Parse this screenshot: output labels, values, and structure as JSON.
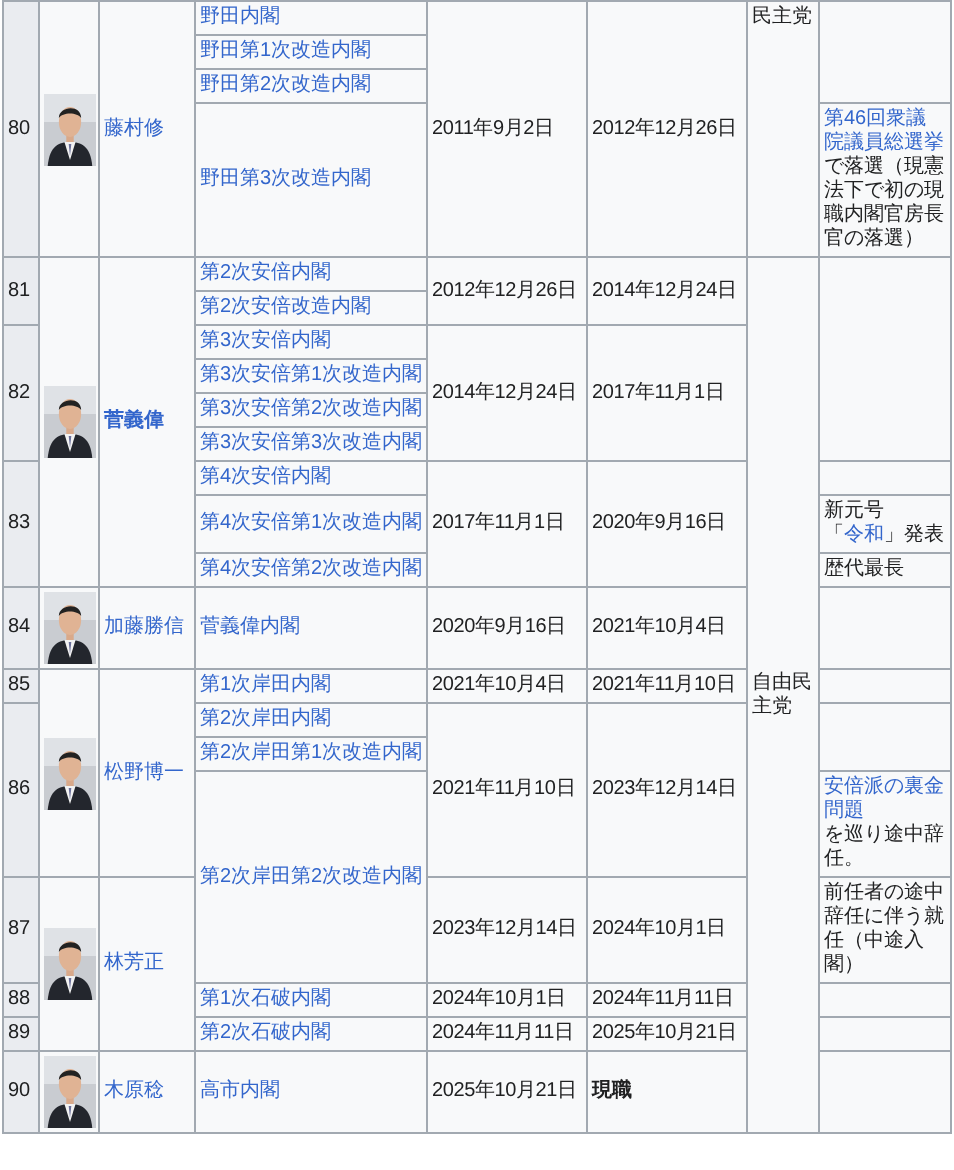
{
  "table": {
    "rows": [
      {
        "number": "80",
        "photo": {
          "kind": "picture"
        },
        "name": {
          "text": "藤村修"
        },
        "cabinet": "野田内閣",
        "start": "2011年9月2日",
        "end": {
          "text": "2012年12月26日"
        },
        "party": {
          "text": "民主党",
          "continued": true
        },
        "note": null
      },
      {
        "cabinet": "野田第1次改造内閣"
      },
      {
        "cabinet": "野田第2次改造内閣"
      },
      {
        "cabinet": "野田第3次改造内閣",
        "note": [
          {
            "text": "第46回衆議院議員総選挙",
            "link": true
          },
          {
            "text": "で落選（現憲法下で初の現職内閣官房長官の落選）",
            "link": false
          }
        ]
      },
      {
        "number": "81",
        "photo": {
          "kind": "picture"
        },
        "name": {
          "text": "菅義偉",
          "bold": true
        },
        "cabinet": "第2次安倍内閣",
        "start": "2012年12月26日",
        "end": {
          "text": "2014年12月24日"
        },
        "party": {
          "text": "自由民主党",
          "continued": false
        },
        "note": null
      },
      {
        "cabinet": "第2次安倍改造内閣"
      },
      {
        "number": "82",
        "cabinet": "第3次安倍内閣",
        "start": "2014年12月24日",
        "end": {
          "text": "2017年11月1日"
        }
      },
      {
        "cabinet": "第3次安倍第1次改造内閣"
      },
      {
        "cabinet": "第3次安倍第2次改造内閣"
      },
      {
        "cabinet": "第3次安倍第3次改造内閣"
      },
      {
        "number": "83",
        "cabinet": "第4次安倍内閣",
        "start": "2017年11月1日",
        "end": {
          "text": "2020年9月16日"
        },
        "note": null
      },
      {
        "cabinet": "第4次安倍第1次改造内閣",
        "note": [
          {
            "text": "新元号「",
            "link": false
          },
          {
            "text": "令和",
            "link": true
          },
          {
            "text": "」発表",
            "link": false
          }
        ]
      },
      {
        "cabinet": "第4次安倍第2次改造内閣",
        "note": [
          {
            "text": "歴代最長",
            "link": false
          }
        ]
      },
      {
        "number": "84",
        "photo": {
          "kind": "picture"
        },
        "name": {
          "text": "加藤勝信"
        },
        "cabinet": "菅義偉内閣",
        "start": "2020年9月16日",
        "end": {
          "text": "2021年10月4日"
        },
        "note": null
      },
      {
        "number": "85",
        "photo": {
          "kind": "picture"
        },
        "name": {
          "text": "松野博一"
        },
        "cabinet": "第1次岸田内閣",
        "start": "2021年10月4日",
        "end": {
          "text": "2021年11月10日"
        },
        "note": null
      },
      {
        "number": "86",
        "cabinet": "第2次岸田内閣",
        "start": "2021年11月10日",
        "end": {
          "text": "2023年12月14日"
        },
        "note": null
      },
      {
        "cabinet": "第2次岸田第1次改造内閣"
      },
      {
        "cabinet": "第2次岸田第2次改造内閣",
        "note": [
          {
            "text": "安倍派の裏金問題",
            "link": true
          },
          {
            "text": "を巡り途中辞任。",
            "link": false
          }
        ]
      },
      {
        "number": "87",
        "photo": {
          "kind": "picture"
        },
        "name": {
          "text": "林芳正"
        },
        "start": "2023年12月14日",
        "end": {
          "text": "2024年10月1日"
        },
        "note": [
          {
            "text": "前任者の途中辞任に伴う就任（中途入閣）",
            "link": false
          }
        ]
      },
      {
        "number": "88",
        "cabinet": "第1次石破内閣",
        "start": "2024年10月1日",
        "end": {
          "text": "2024年11月11日"
        },
        "note": null
      },
      {
        "number": "89",
        "cabinet": "第2次石破内閣",
        "start": "2024年11月11日",
        "end": {
          "text": "2025年10月21日"
        },
        "note": null
      },
      {
        "number": "90",
        "photo": {
          "kind": "picture"
        },
        "name": {
          "text": "木原稔"
        },
        "cabinet": "高市内閣",
        "start": "2025年10月21日",
        "end": {
          "text": "現職",
          "bold": true
        },
        "note": null
      }
    ]
  }
}
